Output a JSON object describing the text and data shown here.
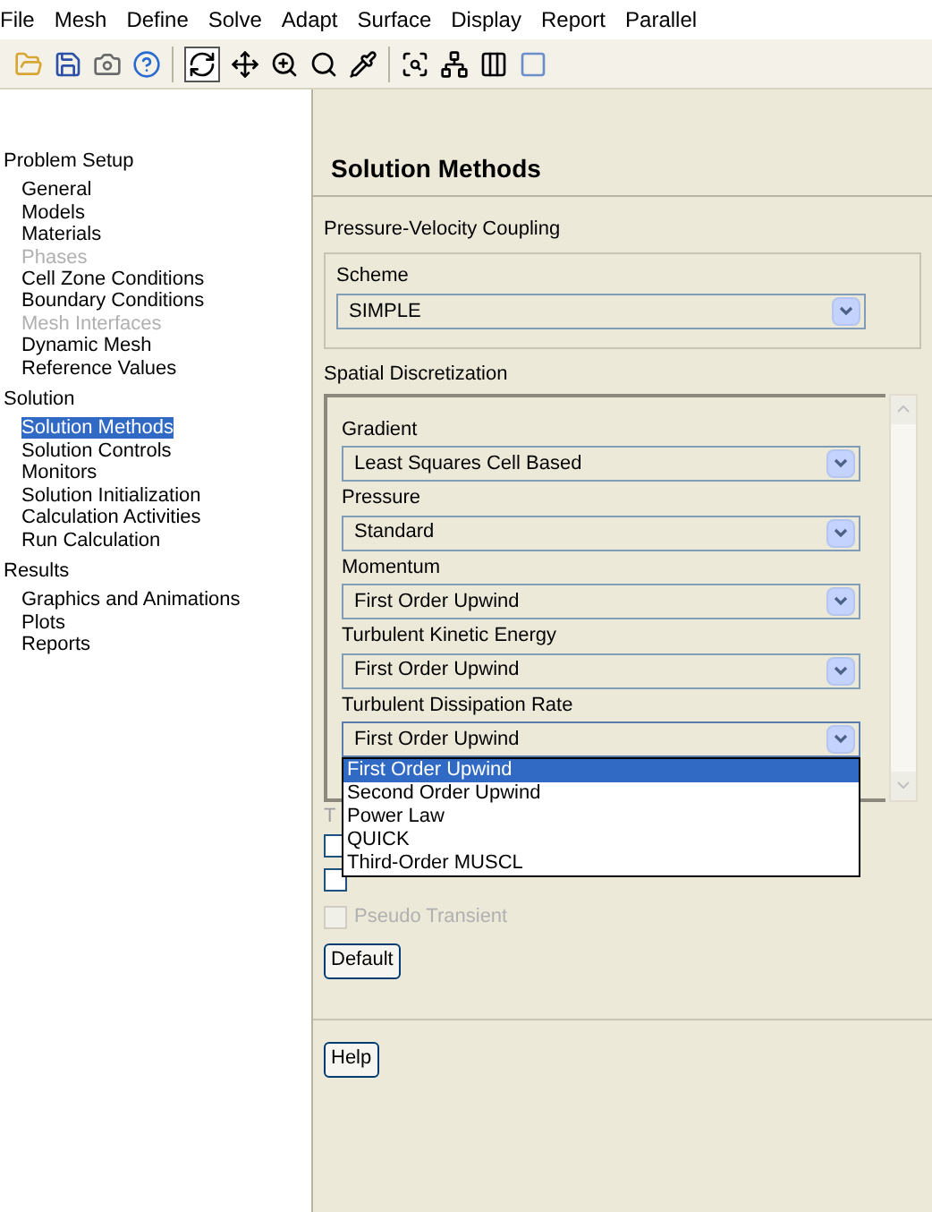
{
  "menu": [
    "File",
    "Mesh",
    "Define",
    "Solve",
    "Adapt",
    "Surface",
    "Display",
    "Report",
    "Parallel"
  ],
  "tree": [
    {
      "label": "Problem Setup",
      "children": [
        {
          "label": "General",
          "disabled": false,
          "selected": false
        },
        {
          "label": "Models",
          "disabled": false,
          "selected": false
        },
        {
          "label": "Materials",
          "disabled": false,
          "selected": false
        },
        {
          "label": "Phases",
          "disabled": true,
          "selected": false
        },
        {
          "label": "Cell Zone Conditions",
          "disabled": false,
          "selected": false
        },
        {
          "label": "Boundary Conditions",
          "disabled": false,
          "selected": false
        },
        {
          "label": "Mesh Interfaces",
          "disabled": true,
          "selected": false
        },
        {
          "label": "Dynamic Mesh",
          "disabled": false,
          "selected": false
        },
        {
          "label": "Reference Values",
          "disabled": false,
          "selected": false
        }
      ]
    },
    {
      "label": "Solution",
      "children": [
        {
          "label": "Solution Methods",
          "disabled": false,
          "selected": true
        },
        {
          "label": "Solution Controls",
          "disabled": false,
          "selected": false
        },
        {
          "label": "Monitors",
          "disabled": false,
          "selected": false
        },
        {
          "label": "Solution Initialization",
          "disabled": false,
          "selected": false
        },
        {
          "label": "Calculation Activities",
          "disabled": false,
          "selected": false
        },
        {
          "label": "Run Calculation",
          "disabled": false,
          "selected": false
        }
      ]
    },
    {
      "label": "Results",
      "children": [
        {
          "label": "Graphics and Animations",
          "disabled": false,
          "selected": false
        },
        {
          "label": "Plots",
          "disabled": false,
          "selected": false
        },
        {
          "label": "Reports",
          "disabled": false,
          "selected": false
        }
      ]
    }
  ],
  "panel": {
    "title": "Solution Methods",
    "coupling": {
      "title": "Pressure-Velocity Coupling",
      "label": "Scheme",
      "value": "SIMPLE"
    },
    "discretization": {
      "title": "Spatial Discretization",
      "fields": [
        {
          "label": "Gradient",
          "value": "Least Squares Cell Based",
          "expanded": false
        },
        {
          "label": "Pressure",
          "value": "Standard",
          "expanded": false
        },
        {
          "label": "Momentum",
          "value": "First Order Upwind",
          "expanded": false
        },
        {
          "label": "Turbulent Kinetic Energy",
          "value": "First Order Upwind",
          "expanded": false
        },
        {
          "label": "Turbulent Dissipation Rate",
          "value": "First Order Upwind",
          "expanded": true,
          "options": [
            {
              "label": "First Order Upwind",
              "selected": true
            },
            {
              "label": "Second Order Upwind",
              "selected": false
            },
            {
              "label": "Power Law",
              "selected": false
            },
            {
              "label": "QUICK",
              "selected": false
            },
            {
              "label": "Third-Order MUSCL",
              "selected": false
            }
          ]
        }
      ]
    },
    "transient_label": "T",
    "checkboxes": [
      {
        "checked": false,
        "disabled": false
      },
      {
        "checked": false,
        "disabled": false
      },
      {
        "label": "Pseudo Transient",
        "checked": false,
        "disabled": true
      }
    ],
    "buttons": [
      "Default",
      "Help"
    ]
  }
}
